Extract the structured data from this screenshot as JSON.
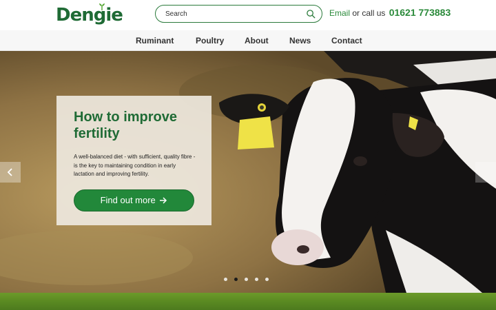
{
  "brand": {
    "name": "Dengie",
    "color": "#1f6b35"
  },
  "search": {
    "placeholder": "Search",
    "icon": "search-icon"
  },
  "contact": {
    "email_label": "Email",
    "or_text": " or call us ",
    "phone": "01621 773883"
  },
  "nav": {
    "items": [
      "Ruminant",
      "Poultry",
      "About",
      "News",
      "Contact"
    ]
  },
  "hero": {
    "title": "How to improve fertility",
    "body": "A well-balanced diet - with sufficient, quality fibre - is the key to maintaining condition in early lactation and improving fertility.",
    "cta_label": "Find out more",
    "cta_icon": "arrow-right-icon",
    "cta_color": "#22883a",
    "prev_icon": "chevron-left-icon",
    "slides_total": 5,
    "active_slide": 2
  }
}
